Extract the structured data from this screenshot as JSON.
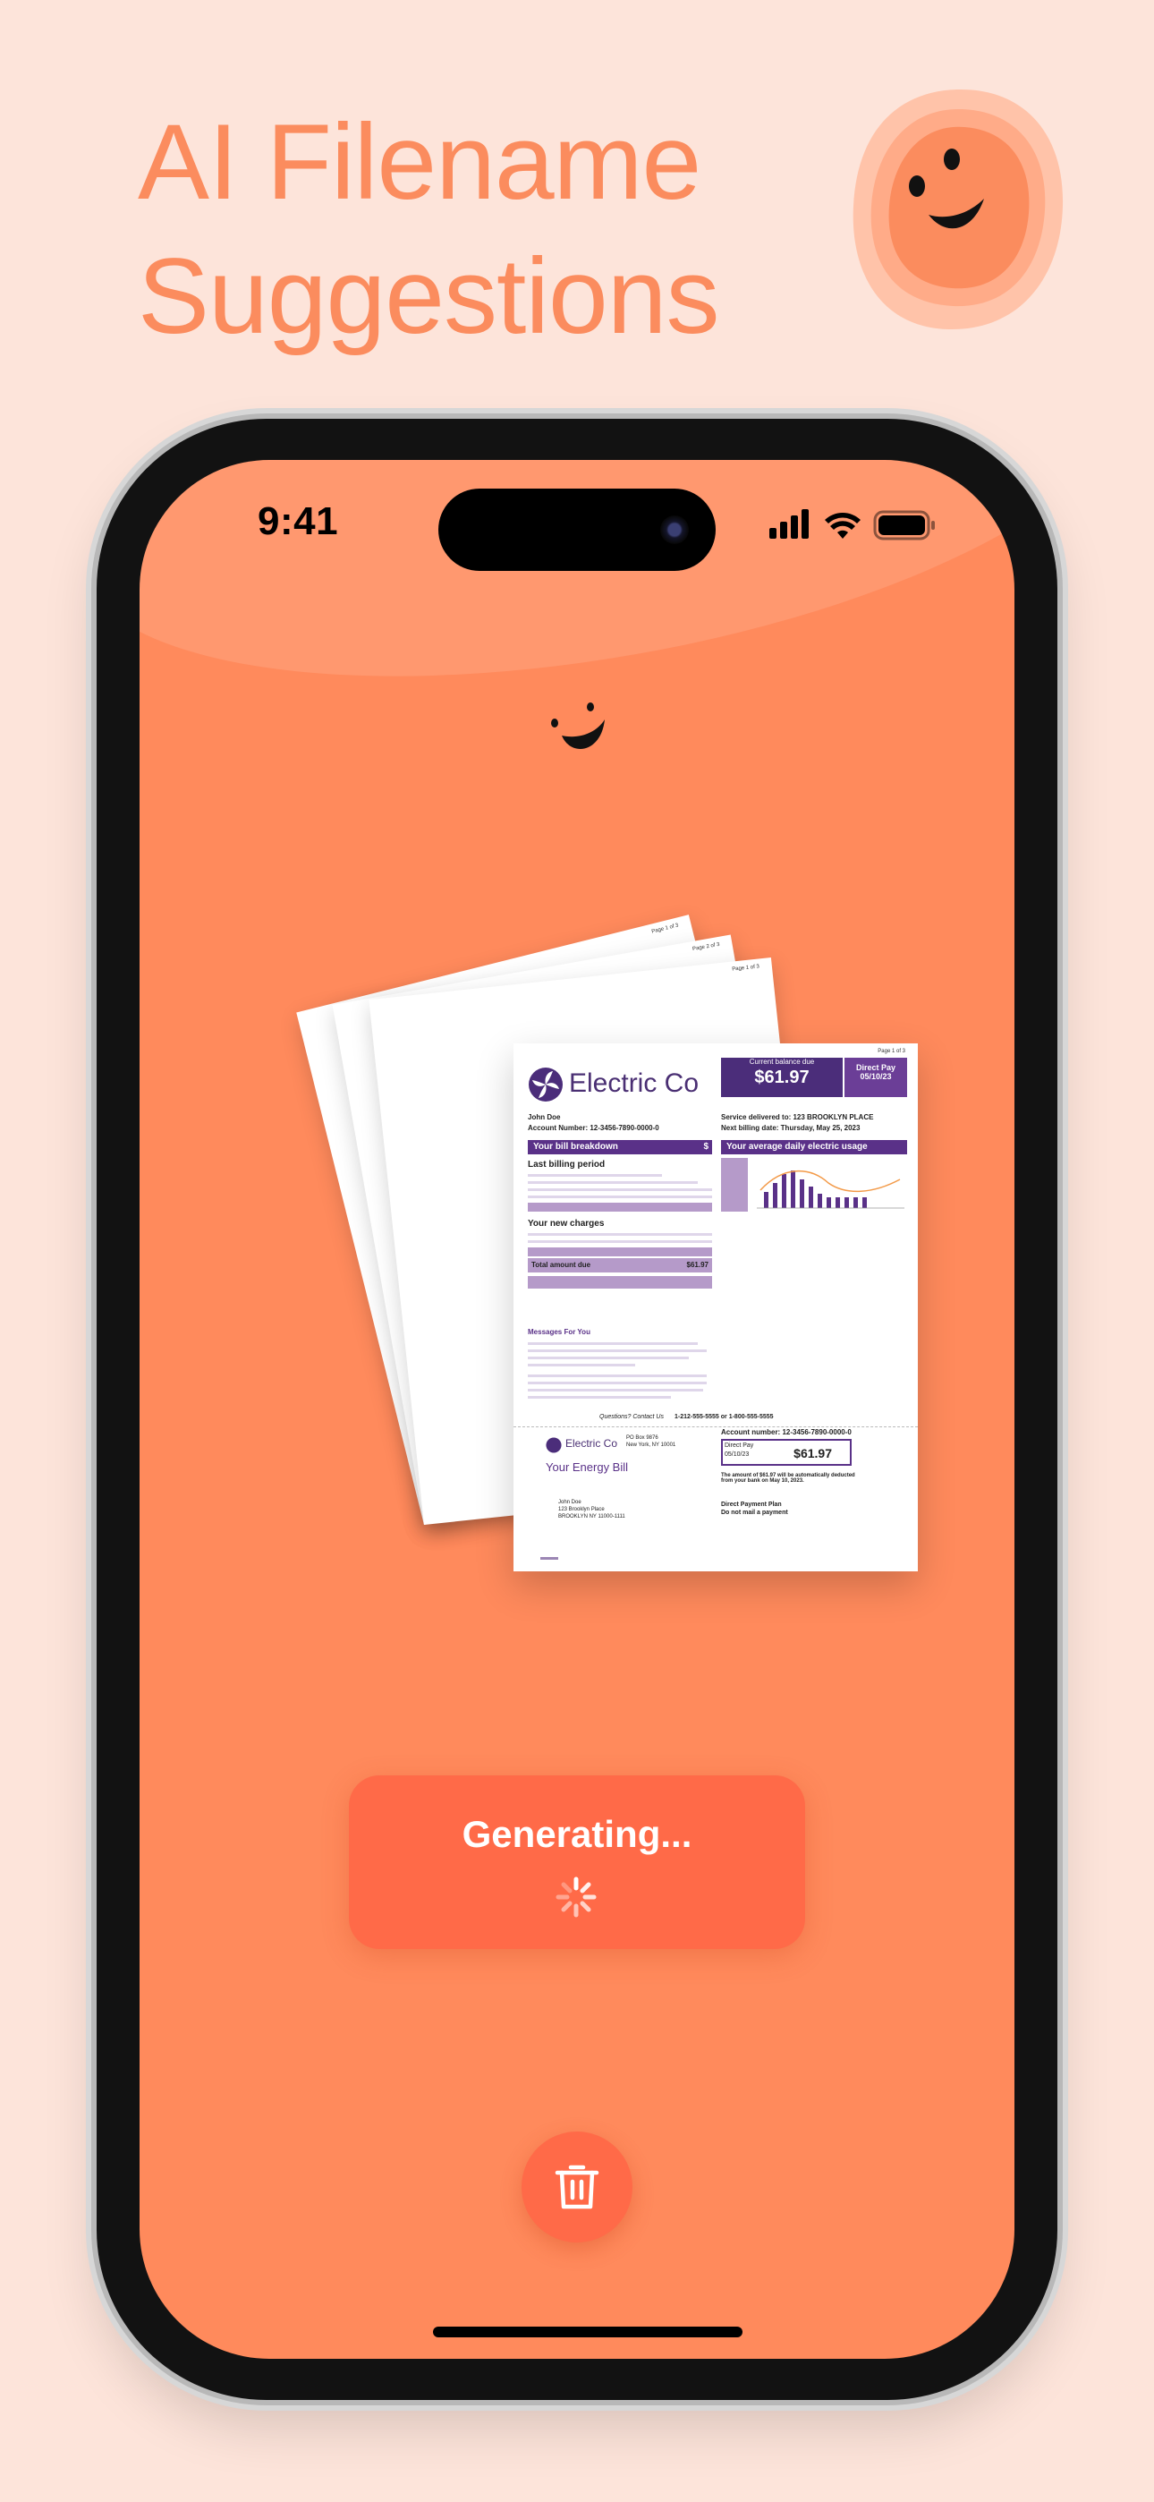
{
  "headline": {
    "line1": "AI Filename",
    "line2": "Suggestions"
  },
  "status_bar": {
    "time": "9:41"
  },
  "document": {
    "page_label": "Page 1 of 3",
    "page_label_2": "Page 2 of 3",
    "brand": "Electric Co",
    "current_balance_label": "Current balance due",
    "amount": "$61.97",
    "direct_pay_label": "Direct Pay",
    "direct_pay_date": "05/10/23",
    "customer_name": "John Doe",
    "account_number": "Account Number: 12-3456-7890-0000-0",
    "service_delivered": "Service delivered to: 123 BROOKLYN PLACE",
    "next_billing": "Next billing date: Thursday, May 25, 2023",
    "bill_breakdown": "Your bill breakdown",
    "bill_breakdown_icon": "$",
    "avg_daily_usage": "Your average daily electric usage",
    "last_billing_period": "Last billing period",
    "new_charges": "Your new charges",
    "total_amount_due_label": "Total amount due",
    "total_amount_due": "$61.97",
    "messages_heading": "Messages For You",
    "questions": "Questions? Contact Us",
    "phone": "1-212-555-5555 or 1-800-555-5555",
    "po_box": "PO Box 9876",
    "city": "New York, NY 10001",
    "your_energy_bill": "Your Energy Bill",
    "account_number_short": "Account number: 12-3456-7890-0000-0",
    "auto_deducted": "The amount of $61.97 will be automatically deducted from your bank on May 10, 2023.",
    "direct_payment_plan": "Direct Payment Plan",
    "do_not_mail": "Do not mail a payment",
    "address_name": "John Doe",
    "address_street": "123 Brooklyn Place",
    "address_city": "BROOKLYN NY 11000-1111"
  },
  "generate_button": {
    "label": "Generating..."
  },
  "icons": {
    "mascot": "smiley-blob-icon",
    "trash": "trash-icon",
    "spinner": "spinner-icon"
  },
  "colors": {
    "background": "#fde4da",
    "accent": "#ff8a5c",
    "button": "#ff6a48",
    "brand_purple": "#4b2d7a"
  }
}
